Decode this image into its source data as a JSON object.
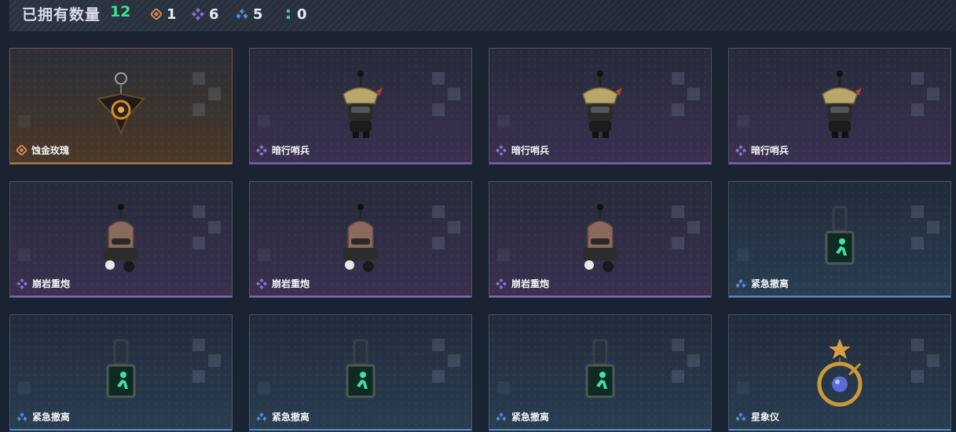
{
  "header": {
    "title": "已拥有数量",
    "total": "12",
    "stats": [
      {
        "rarity": "orange",
        "icon": "orange-diamond-icon",
        "color": "#e08a4e",
        "count": "1"
      },
      {
        "rarity": "purple",
        "icon": "purple-diamond-icon",
        "color": "#8b6fd6",
        "count": "6"
      },
      {
        "rarity": "blue",
        "icon": "blue-diamond-icon",
        "color": "#4f8fd6",
        "count": "5"
      },
      {
        "rarity": "green",
        "icon": "green-dots-icon",
        "color": "#3ecf9a",
        "count": "0"
      }
    ]
  },
  "items": [
    {
      "name": "蚀金玫瑰",
      "rarity": "orange",
      "art": "rose"
    },
    {
      "name": "暗行哨兵",
      "rarity": "purple",
      "art": "sentinel"
    },
    {
      "name": "暗行哨兵",
      "rarity": "purple",
      "art": "sentinel"
    },
    {
      "name": "暗行哨兵",
      "rarity": "purple",
      "art": "sentinel"
    },
    {
      "name": "崩岩重炮",
      "rarity": "purple",
      "art": "cannon"
    },
    {
      "name": "崩岩重炮",
      "rarity": "purple",
      "art": "cannon"
    },
    {
      "name": "崩岩重炮",
      "rarity": "purple",
      "art": "cannon"
    },
    {
      "name": "紧急撤离",
      "rarity": "blue",
      "art": "exit"
    },
    {
      "name": "紧急撤离",
      "rarity": "blue",
      "art": "exit"
    },
    {
      "name": "紧急撤离",
      "rarity": "blue",
      "art": "exit"
    },
    {
      "name": "紧急撤离",
      "rarity": "blue",
      "art": "exit"
    },
    {
      "name": "星象仪",
      "rarity": "blue",
      "art": "astrolabe"
    }
  ]
}
